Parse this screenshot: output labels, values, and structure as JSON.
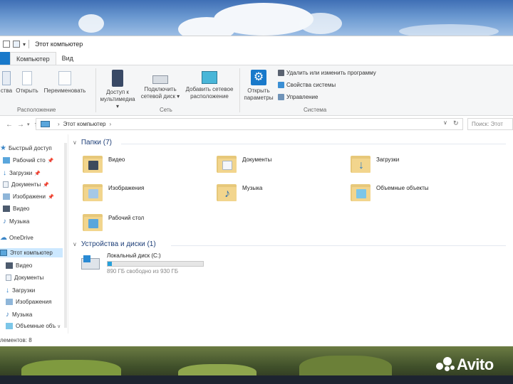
{
  "window": {
    "title": "Этот компьютер"
  },
  "tabs": [
    {
      "label": "Компьютер",
      "active": true
    },
    {
      "label": "Вид",
      "active": false
    }
  ],
  "ribbon": {
    "location_group": {
      "label": "Расположение",
      "items": [
        "ства",
        "Открыть",
        "Переименовать"
      ]
    },
    "network_group": {
      "label": "Сеть",
      "items": [
        {
          "line1": "Доступ к",
          "line2": "мультимедиа",
          "dropdown": true
        },
        {
          "line1": "Подключить",
          "line2": "сетевой диск",
          "dropdown": true
        },
        {
          "line1": "Добавить сетевое",
          "line2": "расположение",
          "dropdown": false
        }
      ]
    },
    "system_group": {
      "label": "Система",
      "open_params": {
        "line1": "Открыть",
        "line2": "параметры"
      },
      "small_items": [
        "Удалить или изменить программу",
        "Свойства системы",
        "Управление"
      ]
    }
  },
  "address": {
    "path": "Этот компьютер",
    "search_placeholder": "Поиск: Этот"
  },
  "sidebar": {
    "quick_access": "Быстрый доступ",
    "quick_items": [
      "Рабочий сто",
      "Загрузки",
      "Документы",
      "Изображени",
      "Видео",
      "Музыка"
    ],
    "onedrive": "OneDrive",
    "this_pc": "Этот компьютер",
    "pc_items": [
      "Видео",
      "Документы",
      "Загрузки",
      "Изображения",
      "Музыка",
      "Объемные объ"
    ]
  },
  "folders_section": {
    "title": "Папки (7)",
    "items": [
      "Видео",
      "Документы",
      "Загрузки",
      "Изображения",
      "Музыка",
      "Объемные объекты",
      "Рабочий стол"
    ]
  },
  "devices_section": {
    "title": "Устройства и диски (1)",
    "disk_name": "Локальный диск (C:)",
    "disk_free_text": "890 ГБ свободно из 930 ГБ",
    "used_fraction": 0.043
  },
  "status": {
    "text": "лементов: 8"
  },
  "watermark": {
    "text": "Avito"
  },
  "colors": {
    "accent": "#1979ca",
    "selection": "#cce8ff",
    "header_text": "#1e3f78",
    "disk_fill": "#26a0da"
  }
}
